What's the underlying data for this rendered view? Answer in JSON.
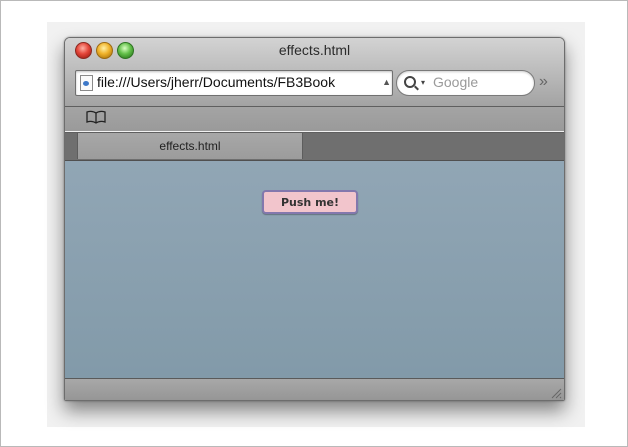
{
  "window": {
    "title": "effects.html"
  },
  "toolbar": {
    "url": "file:///Users/jherr/Documents/FB3Book",
    "search_placeholder": "Google",
    "overflow_label": "»"
  },
  "tabs": [
    {
      "label": "effects.html"
    }
  ],
  "page": {
    "button_label": "Push me!"
  },
  "colors": {
    "content_background": "#8a9fae",
    "button_fill": "#f2c5cc",
    "button_border": "#8378ad"
  },
  "icons": [
    "close-icon",
    "minimize-icon",
    "zoom-icon",
    "page-icon",
    "search-icon",
    "bookmarks-icon",
    "resize-grip-icon"
  ]
}
